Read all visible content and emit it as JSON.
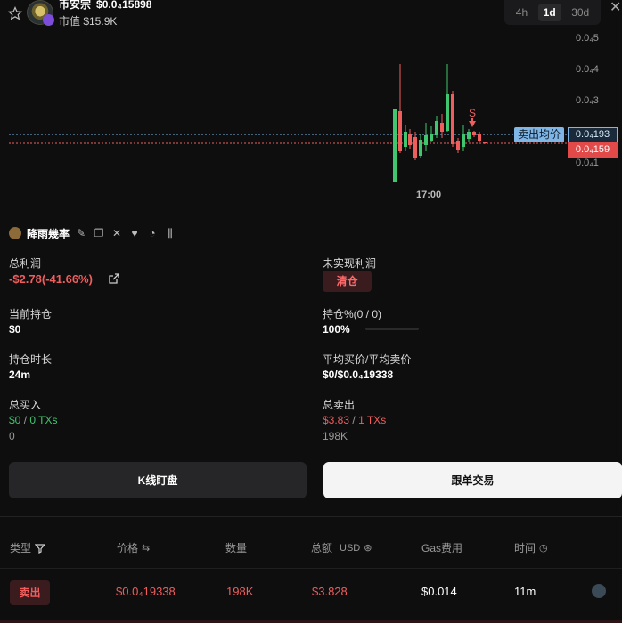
{
  "token": {
    "name": "币安宗",
    "price": "$0.0₄15898",
    "mcap": "市值 $15.9K"
  },
  "timeframes": [
    {
      "label": "4h",
      "active": false
    },
    {
      "label": "1d",
      "active": true
    },
    {
      "label": "30d",
      "active": false
    }
  ],
  "chart": {
    "y_ticks": [
      "0.0₄5",
      "0.0₄4",
      "0.0₄3",
      "0.0₄1"
    ],
    "x_tick": "17:00",
    "sell_marker": "S",
    "sell_avg_label": "卖出均价",
    "sell_avg_value": "0.0₄193",
    "current_value": "0.0₄159",
    "colors": {
      "up": "#3fc66e",
      "down": "#ef5d5d",
      "avg_line": "#7fb6e6"
    }
  },
  "chart_data": {
    "type": "candlestick",
    "title": "",
    "y_ticks": [
      "0.0₄5",
      "0.0₄4",
      "0.0₄3",
      "0.0₄1"
    ],
    "x_ticks": [
      "17:00"
    ],
    "sell_average_price": "0.0₄193",
    "last_price": "0.0₄159",
    "markers": [
      {
        "label": "S",
        "type": "sell"
      }
    ]
  },
  "user": {
    "name": "降雨幾率"
  },
  "stats": {
    "total_profit_label": "总利润",
    "total_profit_value": "-$2.78(-41.66%)",
    "unrealized_label": "未实现利润",
    "clear_label": "清仓",
    "holding_label": "当前持仓",
    "holding_value": "$0",
    "holding_pct_label": "持仓%(0 / 0)",
    "holding_pct_value": "100%",
    "hold_time_label": "持仓时长",
    "hold_time_value": "24m",
    "avg_price_label": "平均买价/平均卖价",
    "avg_price_value": "$0/$0.0₄19338",
    "total_buy_label": "总买入",
    "total_buy_value": "$0",
    "total_buy_txs": "0 TXs",
    "total_buy_amount": "0",
    "total_sell_label": "总卖出",
    "total_sell_value": "$3.83",
    "total_sell_txs": "1 TXs",
    "total_sell_amount": "198K",
    "slash": "/"
  },
  "buttons": {
    "kline": "K线盯盘",
    "copy_trade": "跟单交易"
  },
  "table": {
    "headers": {
      "type": "类型",
      "price": "价格",
      "amount": "数量",
      "total": "总额",
      "total_unit": "USD",
      "gas": "Gas费用",
      "time": "时间"
    },
    "rows": [
      {
        "type": "卖出",
        "price": "$0.0₄19338",
        "amount": "198K",
        "total": "$3.828",
        "gas": "$0.014",
        "time": "11m"
      }
    ]
  }
}
